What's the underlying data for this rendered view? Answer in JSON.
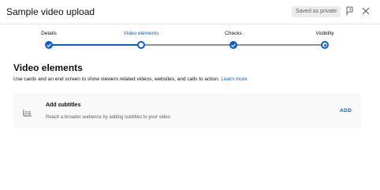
{
  "header": {
    "title": "Sample video upload",
    "saved_badge": "Saved as private",
    "feedback_icon": "feedback-flag-icon",
    "close_icon": "close-icon"
  },
  "stepper": {
    "steps": [
      {
        "label": "Details",
        "state": "done"
      },
      {
        "label": "Video elements",
        "state": "current"
      },
      {
        "label": "Checks",
        "state": "done"
      },
      {
        "label": "Visibility",
        "state": "next"
      }
    ]
  },
  "section": {
    "title": "Video elements",
    "description": "Use cards and an end screen to show viewers related videos, websites, and calls to action.",
    "learn_more": "Learn more"
  },
  "subtitles_card": {
    "icon": "subtitles-icon",
    "title": "Add subtitles",
    "description": "Reach a broader audience by adding subtitles to your video",
    "action": "ADD"
  },
  "colors": {
    "accent": "#065fd4",
    "card_background": "#f9f9f9",
    "badge_background": "#ececec"
  }
}
